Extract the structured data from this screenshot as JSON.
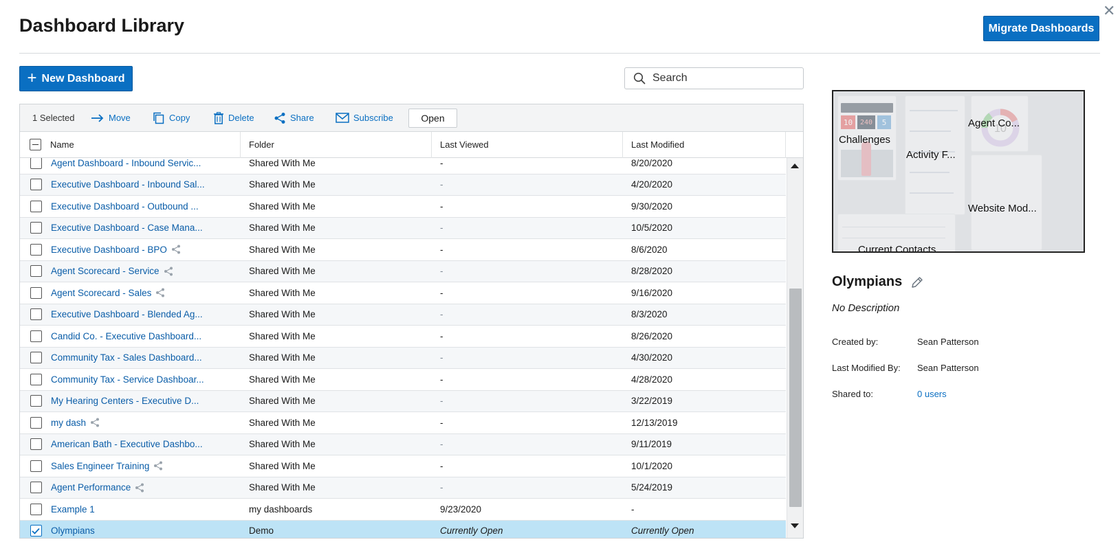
{
  "header": {
    "title": "Dashboard Library",
    "migrate_label": "Migrate Dashboards",
    "close_glyph": "✕"
  },
  "actions": {
    "new_label": "New Dashboard",
    "search_placeholder": "Search"
  },
  "toolbar": {
    "selected_count": "1 Selected",
    "move": "Move",
    "copy": "Copy",
    "delete": "Delete",
    "share": "Share",
    "subscribe": "Subscribe",
    "open": "Open"
  },
  "columns": {
    "name": "Name",
    "folder": "Folder",
    "last_viewed": "Last Viewed",
    "last_modified": "Last Modified"
  },
  "rows": [
    {
      "name": "Agent Dashboard - Inbound Servic...",
      "folder": "Shared With Me",
      "viewed": "-",
      "modified": "8/20/2020",
      "shared": false,
      "checked": false
    },
    {
      "name": "Executive Dashboard - Inbound Sal...",
      "folder": "Shared With Me",
      "viewed": "-",
      "modified": "4/20/2020",
      "shared": false,
      "checked": false
    },
    {
      "name": "Executive Dashboard - Outbound ...",
      "folder": "Shared With Me",
      "viewed": "-",
      "modified": "9/30/2020",
      "shared": false,
      "checked": false
    },
    {
      "name": "Executive Dashboard - Case Mana...",
      "folder": "Shared With Me",
      "viewed": "-",
      "modified": "10/5/2020",
      "shared": false,
      "checked": false
    },
    {
      "name": "Executive Dashboard - BPO",
      "folder": "Shared With Me",
      "viewed": "-",
      "modified": "8/6/2020",
      "shared": true,
      "checked": false
    },
    {
      "name": "Agent Scorecard - Service",
      "folder": "Shared With Me",
      "viewed": "-",
      "modified": "8/28/2020",
      "shared": true,
      "checked": false
    },
    {
      "name": "Agent Scorecard - Sales",
      "folder": "Shared With Me",
      "viewed": "-",
      "modified": "9/16/2020",
      "shared": true,
      "checked": false
    },
    {
      "name": "Executive Dashboard - Blended Ag...",
      "folder": "Shared With Me",
      "viewed": "-",
      "modified": "8/3/2020",
      "shared": false,
      "checked": false
    },
    {
      "name": "Candid Co. - Executive Dashboard...",
      "folder": "Shared With Me",
      "viewed": "-",
      "modified": "8/26/2020",
      "shared": false,
      "checked": false
    },
    {
      "name": "Community Tax - Sales Dashboard...",
      "folder": "Shared With Me",
      "viewed": "-",
      "modified": "4/30/2020",
      "shared": false,
      "checked": false
    },
    {
      "name": "Community Tax - Service Dashboar...",
      "folder": "Shared With Me",
      "viewed": "-",
      "modified": "4/28/2020",
      "shared": false,
      "checked": false
    },
    {
      "name": "My Hearing Centers - Executive D...",
      "folder": "Shared With Me",
      "viewed": "-",
      "modified": "3/22/2019",
      "shared": false,
      "checked": false
    },
    {
      "name": "my dash",
      "folder": "Shared With Me",
      "viewed": "-",
      "modified": "12/13/2019",
      "shared": true,
      "checked": false
    },
    {
      "name": "American Bath - Executive Dashbo...",
      "folder": "Shared With Me",
      "viewed": "-",
      "modified": "9/11/2019",
      "shared": false,
      "checked": false
    },
    {
      "name": "Sales Engineer Training",
      "folder": "Shared With Me",
      "viewed": "-",
      "modified": "10/1/2020",
      "shared": true,
      "checked": false
    },
    {
      "name": "Agent Performance",
      "folder": "Shared With Me",
      "viewed": "-",
      "modified": "5/24/2019",
      "shared": true,
      "checked": false
    },
    {
      "name": "Example 1",
      "folder": "my dashboards",
      "viewed": "9/23/2020",
      "modified": "-",
      "shared": false,
      "checked": false
    },
    {
      "name": "Olympians",
      "folder": "Demo",
      "viewed": "Currently Open",
      "modified": "Currently Open",
      "shared": false,
      "checked": true
    }
  ],
  "preview": {
    "tiles": [
      "Challenges",
      "Activity F...",
      "Agent Co...",
      "Website Mod...",
      "Current Contacts"
    ],
    "scoreboard": [
      "10",
      "240",
      "5"
    ],
    "donut_value": "10"
  },
  "details": {
    "name": "Olympians",
    "description": "No Description",
    "created_by_label": "Created by:",
    "created_by": "Sean Patterson",
    "modified_by_label": "Last Modified By:",
    "modified_by": "Sean Patterson",
    "shared_to_label": "Shared to:",
    "shared_to": "0 users"
  },
  "colors": {
    "primary": "#0a6fc2",
    "link": "#0a5da8",
    "selected_row": "#bde3f6"
  }
}
